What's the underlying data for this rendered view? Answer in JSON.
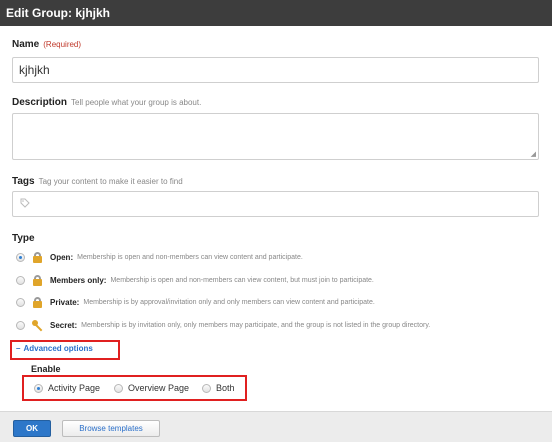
{
  "dialog": {
    "title": "Edit Group: kjhjkh"
  },
  "name_field": {
    "label": "Name",
    "required": "(Required)",
    "value": "kjhjkh"
  },
  "description_field": {
    "label": "Description",
    "hint": "Tell people what your group is about.",
    "value": ""
  },
  "tags_field": {
    "label": "Tags",
    "hint": "Tag your content to make it easier to find",
    "icon": "tag-icon"
  },
  "type": {
    "label": "Type",
    "selected": "Open",
    "options": [
      {
        "name": "Open:",
        "description": "Membership is open and non-members can view content and participate.",
        "icon": "lock-open-icon",
        "checked": true
      },
      {
        "name": "Members only:",
        "description": "Membership is open and non-members can view content, but must join to participate.",
        "icon": "lock-icon",
        "checked": false
      },
      {
        "name": "Private:",
        "description": "Membership is by approval/invitation only and only members can view content and participate.",
        "icon": "lock-icon",
        "checked": false
      },
      {
        "name": "Secret:",
        "description": "Membership is by invitation only, only members may participate, and the group is not listed in the group directory.",
        "icon": "key-icon",
        "checked": false
      }
    ]
  },
  "advanced": {
    "label": "Advanced options",
    "toggle": "–",
    "enable_label": "Enable",
    "options": [
      {
        "label": "Activity Page",
        "checked": true
      },
      {
        "label": "Overview Page",
        "checked": false
      },
      {
        "label": "Both",
        "checked": false
      }
    ]
  },
  "footer": {
    "ok_label": "OK",
    "browse_label": "Browse templates"
  },
  "colors": {
    "titlebar": "#3d3d3d",
    "accent": "#2d77c9",
    "highlight": "#e02020",
    "lock": "#e0a52a"
  }
}
